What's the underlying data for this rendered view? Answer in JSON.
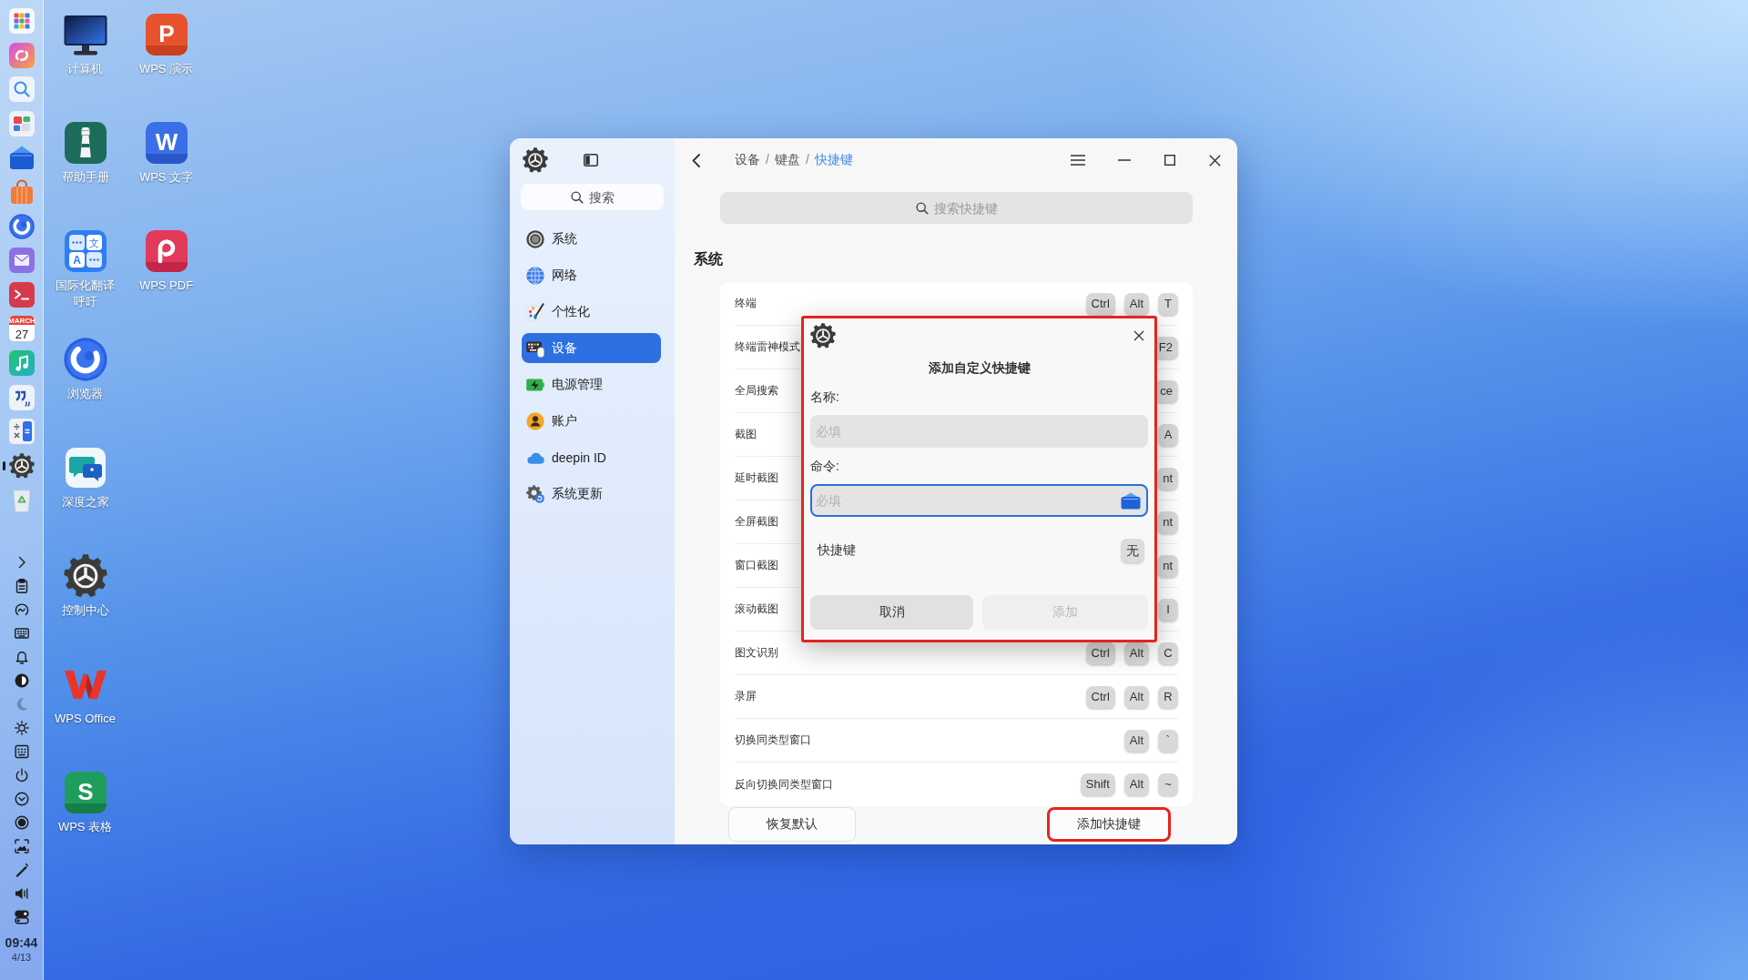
{
  "dock": {
    "apps": [
      {
        "kind": "launcher",
        "running": false
      },
      {
        "kind": "assistant",
        "running": false
      },
      {
        "kind": "search",
        "running": false
      },
      {
        "kind": "multitask",
        "running": false
      },
      {
        "kind": "files",
        "running": false
      },
      {
        "kind": "store",
        "running": false
      },
      {
        "kind": "browser",
        "running": false
      },
      {
        "kind": "mail",
        "running": false
      },
      {
        "kind": "terminal",
        "running": false
      },
      {
        "kind": "calendar",
        "running": false,
        "glyphs": [
          "MARCH",
          "27"
        ]
      },
      {
        "kind": "music",
        "running": false
      },
      {
        "kind": "notes",
        "running": false
      },
      {
        "kind": "calculator",
        "running": false
      },
      {
        "kind": "settings",
        "running": true
      },
      {
        "kind": "trash",
        "running": false
      }
    ],
    "tray": [
      {
        "kind": "expand",
        "disabled": false
      },
      {
        "kind": "clipboard",
        "disabled": false
      },
      {
        "kind": "gauge",
        "disabled": false
      },
      {
        "kind": "keyboard",
        "disabled": false
      },
      {
        "kind": "bell",
        "disabled": false
      },
      {
        "kind": "contrast",
        "disabled": false
      },
      {
        "kind": "moon",
        "disabled": true
      },
      {
        "kind": "brightness",
        "disabled": false
      },
      {
        "kind": "onscreen-keyboard",
        "disabled": false
      },
      {
        "kind": "power",
        "disabled": false
      },
      {
        "kind": "collapse",
        "disabled": false
      },
      {
        "kind": "record",
        "disabled": false
      },
      {
        "kind": "screenshot",
        "disabled": false
      },
      {
        "kind": "pen",
        "disabled": false
      },
      {
        "kind": "volume",
        "disabled": false
      },
      {
        "kind": "toggles",
        "disabled": false
      }
    ],
    "clock": {
      "time": "09:44",
      "date": "4/13"
    }
  },
  "desktop_icons": [
    {
      "kind": "computer",
      "label": "计算机"
    },
    {
      "kind": "manual",
      "label": "帮助手册"
    },
    {
      "kind": "translate",
      "label": "国际化翻译呼吁",
      "glyphs": [
        "文",
        "A"
      ]
    },
    {
      "kind": "browser",
      "label": "浏览器"
    },
    {
      "kind": "community",
      "label": "深度之家"
    },
    {
      "kind": "settings",
      "label": "控制中心"
    },
    {
      "kind": "office",
      "label": "WPS Office"
    },
    {
      "kind": "spreadsheet",
      "label": "WPS 表格",
      "glyphs": [
        "S"
      ]
    },
    {
      "kind": "slides",
      "label": "WPS 演示",
      "glyphs": [
        "P"
      ]
    },
    {
      "kind": "writer",
      "label": "WPS 文字",
      "glyphs": [
        "W"
      ]
    },
    {
      "kind": "pdf",
      "label": "WPS PDF"
    }
  ],
  "settings_window": {
    "sidebar": {
      "search": {
        "placeholder": "搜索"
      },
      "items": [
        {
          "kind": "system",
          "label": "系统",
          "selected": false
        },
        {
          "kind": "network",
          "label": "网络",
          "selected": false
        },
        {
          "kind": "personalization",
          "label": "个性化",
          "selected": false
        },
        {
          "kind": "devices",
          "label": "设备",
          "selected": true
        },
        {
          "kind": "power",
          "label": "电源管理",
          "selected": false
        },
        {
          "kind": "accounts",
          "label": "账户",
          "selected": false
        },
        {
          "kind": "cloud",
          "label": "deepin ID",
          "selected": false
        },
        {
          "kind": "update",
          "label": "系统更新",
          "selected": false
        }
      ]
    },
    "breadcrumb": [
      {
        "label": "设备",
        "current": false
      },
      {
        "separator": "/",
        "label": "键盘",
        "current": false
      },
      {
        "separator": "/",
        "label": "快捷键",
        "current": true
      }
    ],
    "search": {
      "placeholder": "搜索快捷键"
    },
    "section_title": "系统",
    "shortcuts": [
      {
        "name": "终端",
        "keys": [
          "Ctrl",
          "Alt",
          "T"
        ]
      },
      {
        "name": "终端雷神模式",
        "keys": [
          "F2"
        ]
      },
      {
        "name": "全局搜索",
        "keys": [
          "ce"
        ]
      },
      {
        "name": "截图",
        "keys": [
          "A"
        ]
      },
      {
        "name": "延时截图",
        "keys": [
          "nt"
        ]
      },
      {
        "name": "全屏截图",
        "keys": [
          "nt"
        ]
      },
      {
        "name": "窗口截图",
        "keys": [
          "nt"
        ]
      },
      {
        "name": "滚动截图",
        "keys": [
          "I"
        ]
      },
      {
        "name": "图文识别",
        "keys": [
          "Ctrl",
          "Alt",
          "C"
        ]
      },
      {
        "name": "录屏",
        "keys": [
          "Ctrl",
          "Alt",
          "R"
        ]
      },
      {
        "name": "切换同类型窗口",
        "keys": [
          "Alt",
          "`"
        ]
      },
      {
        "name": "反向切换同类型窗口",
        "keys": [
          "Shift",
          "Alt",
          "~"
        ]
      }
    ],
    "buttons": [
      {
        "label": "恢复默认",
        "highlighted": false
      },
      {
        "label": "添加快捷键",
        "highlighted": true
      }
    ]
  },
  "dialog": {
    "title": "添加自定义快捷键",
    "highlighted": true,
    "fields": [
      {
        "kind": "text",
        "label": "名称:",
        "placeholder": "必填",
        "focused": false
      },
      {
        "kind": "file",
        "label": "命令:",
        "placeholder": "必填",
        "focused": true
      }
    ],
    "shortcut": {
      "label": "快捷键",
      "key": "无"
    },
    "buttons": [
      {
        "label": "取消",
        "disabled": false
      },
      {
        "label": "添加",
        "disabled": true
      }
    ]
  }
}
